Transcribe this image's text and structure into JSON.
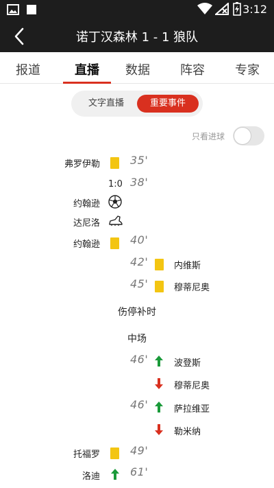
{
  "status_bar": {
    "time": "3:12",
    "icons": [
      "image-icon",
      "square-icon",
      "wifi-icon",
      "no-signal-icon",
      "battery-charging-icon"
    ]
  },
  "header": {
    "title": "诺丁汉森林 1 - 1 狼队",
    "back_icon": "chevron-left-icon"
  },
  "tabs": [
    {
      "label": "报道",
      "active": false
    },
    {
      "label": "直播",
      "active": true
    },
    {
      "label": "数据",
      "active": false
    },
    {
      "label": "阵容",
      "active": false
    },
    {
      "label": "专家",
      "active": false
    }
  ],
  "segments": {
    "text_live": "文字直播",
    "key_events": "重要事件",
    "selected": "重要事件"
  },
  "goal_filter": {
    "label": "只看进球",
    "on": false
  },
  "colors": {
    "accent": "#d9301f",
    "yellow_card": "#f3c512",
    "sub_in": "#1a9a3a",
    "sub_out": "#d9301f",
    "dark_bar": "#1d1d1d"
  },
  "events": [
    {
      "side": "home",
      "player": "弗罗伊勒",
      "type": "yellow-card",
      "minute": "35'"
    },
    {
      "side": "home",
      "score": "1:0",
      "minute": "38'"
    },
    {
      "side": "home",
      "player": "约翰逊",
      "type": "goal"
    },
    {
      "side": "home",
      "player": "达尼洛",
      "type": "assist"
    },
    {
      "side": "home",
      "player": "约翰逊",
      "type": "yellow-card",
      "minute": "40'"
    },
    {
      "side": "away",
      "player": "内维斯",
      "type": "yellow-card",
      "minute": "42'"
    },
    {
      "side": "away",
      "player": "穆蒂尼奥",
      "type": "yellow-card",
      "minute": "45'"
    },
    {
      "divider": "伤停补时"
    },
    {
      "divider": "中场"
    },
    {
      "side": "away",
      "player": "波登斯",
      "type": "sub-in",
      "minute": "46'"
    },
    {
      "side": "away",
      "player": "穆蒂尼奥",
      "type": "sub-out"
    },
    {
      "side": "away",
      "player": "萨拉维亚",
      "type": "sub-in",
      "minute": "46'"
    },
    {
      "side": "away",
      "player": "勒米纳",
      "type": "sub-out"
    },
    {
      "side": "home",
      "player": "托福罗",
      "type": "yellow-card",
      "minute": "49'"
    },
    {
      "side": "home",
      "player": "洛迪",
      "type": "sub-in",
      "minute": "61'"
    }
  ]
}
